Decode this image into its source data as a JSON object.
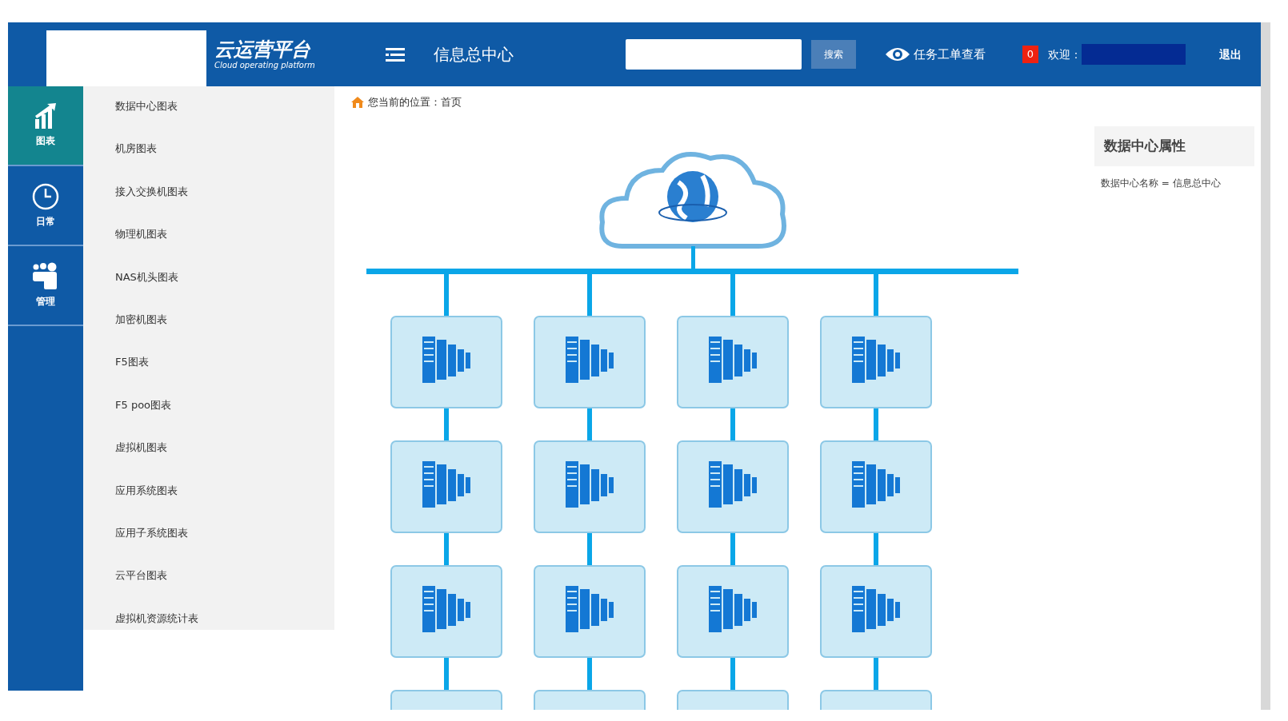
{
  "header": {
    "logo_title": "云运营平台",
    "logo_subtitle": "Cloud operating platform",
    "center_name": "信息总中心",
    "search_button": "搜索",
    "tasks_link": "任务工单查看",
    "badge": "0",
    "welcome": "欢迎：",
    "logout": "退出"
  },
  "nav": [
    {
      "label": "图表",
      "kind": "chart",
      "selected": true
    },
    {
      "label": "日常",
      "kind": "clock",
      "selected": false
    },
    {
      "label": "管理",
      "kind": "people",
      "selected": false
    }
  ],
  "menu": [
    "数据中心图表",
    "机房图表",
    "接入交换机图表",
    "物理机图表",
    "NAS机头图表",
    "加密机图表",
    "F5图表",
    "F5 poo图表",
    "虚拟机图表",
    "应用系统图表",
    "应用子系统图表",
    "云平台图表",
    "虚拟机资源统计表"
  ],
  "breadcrumb": "您当前的位置：首页",
  "properties": {
    "title": "数据中心属性",
    "rows": [
      "数据中心名称 = 信息总中心"
    ]
  }
}
